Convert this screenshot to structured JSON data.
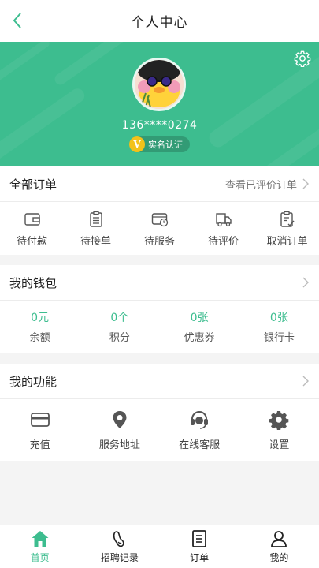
{
  "header": {
    "title": "个人中心"
  },
  "profile": {
    "phone": "136****0274",
    "verify_badge": "V",
    "verify_label": "实名认证"
  },
  "orders": {
    "title": "全部订单",
    "link": "查看已评价订单",
    "items": [
      {
        "label": "待付款",
        "icon": "wallet-icon"
      },
      {
        "label": "待接单",
        "icon": "clipboard-icon"
      },
      {
        "label": "待服务",
        "icon": "card-clock-icon"
      },
      {
        "label": "待评价",
        "icon": "truck-icon"
      },
      {
        "label": "取消订单",
        "icon": "cancel-doc-icon"
      }
    ]
  },
  "wallet": {
    "title": "我的钱包",
    "items": [
      {
        "value": "0元",
        "label": "余额"
      },
      {
        "value": "0个",
        "label": "积分"
      },
      {
        "value": "0张",
        "label": "优惠券"
      },
      {
        "value": "0张",
        "label": "银行卡"
      }
    ]
  },
  "functions": {
    "title": "我的功能",
    "items": [
      {
        "label": "充值",
        "icon": "card-icon"
      },
      {
        "label": "服务地址",
        "icon": "location-icon"
      },
      {
        "label": "在线客服",
        "icon": "headset-icon"
      },
      {
        "label": "设置",
        "icon": "gear-icon"
      }
    ]
  },
  "tabbar": {
    "items": [
      {
        "label": "首页",
        "icon": "home-icon",
        "active": true
      },
      {
        "label": "招聘记录",
        "icon": "footprint-icon",
        "active": false
      },
      {
        "label": "订单",
        "icon": "list-icon",
        "active": false
      },
      {
        "label": "我的",
        "icon": "user-icon",
        "active": false
      }
    ]
  },
  "colors": {
    "accent": "#3dbd8f",
    "badge": "#f2c21a"
  }
}
